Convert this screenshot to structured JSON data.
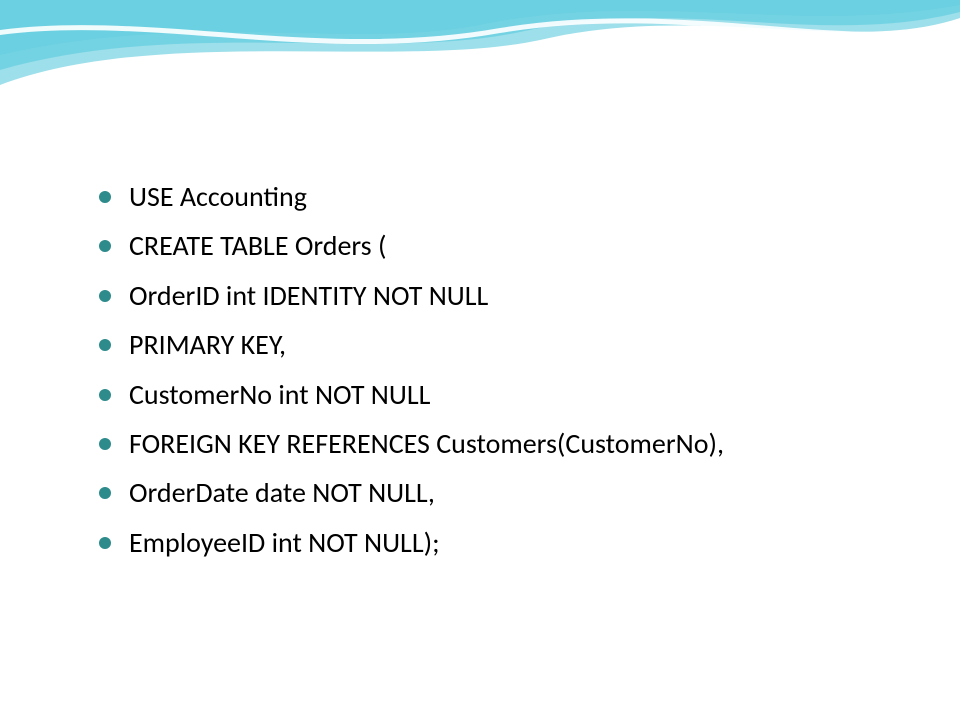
{
  "bullets": {
    "b0": "USE Accounting",
    "b1": "CREATE TABLE Orders (",
    "b2": "OrderID int IDENTITY NOT NULL",
    "b3": "PRIMARY KEY,",
    "b4": "CustomerNo int NOT NULL",
    "b5": "FOREIGN KEY REFERENCES Customers(CustomerNo),",
    "b6": "OrderDate date NOT NULL,",
    "b7": "EmployeeID int NOT NULL);"
  },
  "theme": {
    "accent": "#2e8b8b",
    "wave_light": "#a8e6f0",
    "wave_dark": "#3db5c8"
  }
}
